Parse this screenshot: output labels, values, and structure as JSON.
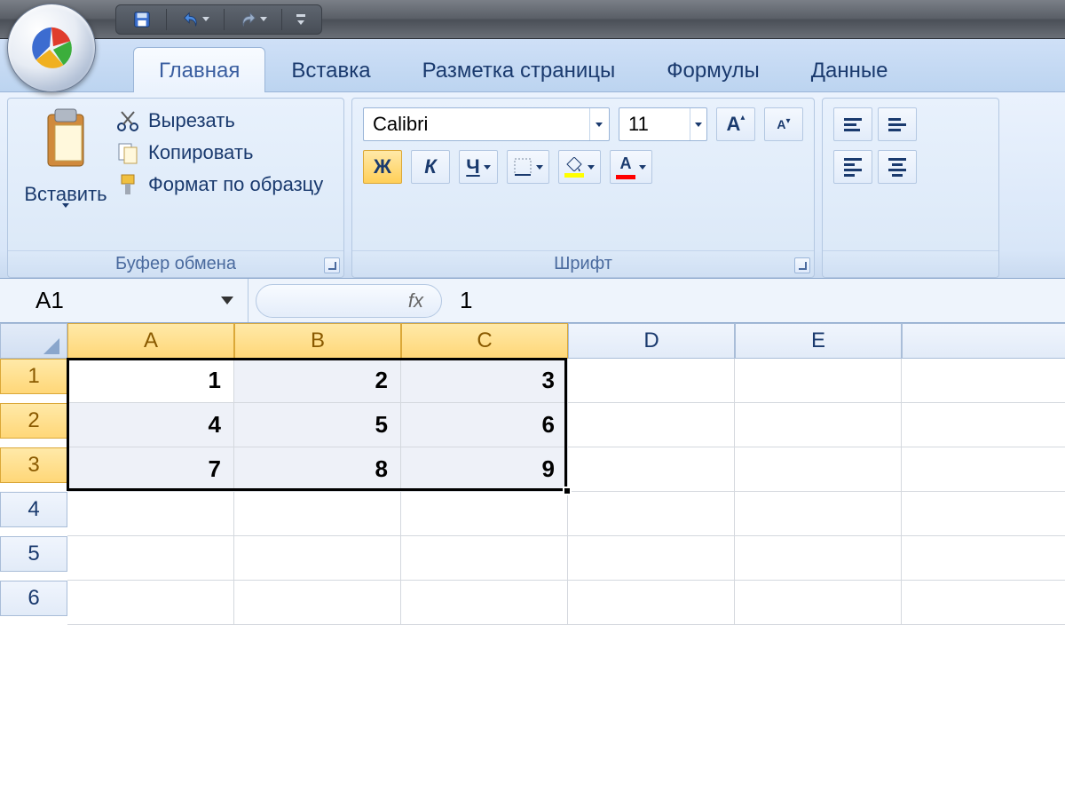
{
  "qat": {
    "save": "save-icon",
    "undo": "undo-icon",
    "redo": "redo-icon"
  },
  "tabs": [
    {
      "label": "Главная",
      "active": true
    },
    {
      "label": "Вставка"
    },
    {
      "label": "Разметка страницы"
    },
    {
      "label": "Формулы"
    },
    {
      "label": "Данные"
    }
  ],
  "clipboard": {
    "paste": "Вставить",
    "cut": "Вырезать",
    "copy": "Копировать",
    "format_painter": "Формат по образцу",
    "group_label": "Буфер обмена"
  },
  "font": {
    "name": "Calibri",
    "size": "11",
    "bold": "Ж",
    "italic": "К",
    "underline": "Ч",
    "group_label": "Шрифт",
    "grow": "A",
    "shrink": "A",
    "font_color": "A",
    "fill_color": "◇"
  },
  "formula_bar": {
    "cell_ref": "A1",
    "fx": "fx",
    "value": "1"
  },
  "columns": [
    "A",
    "B",
    "C",
    "D",
    "E",
    ""
  ],
  "rows": [
    "1",
    "2",
    "3",
    "4",
    "5",
    "6"
  ],
  "selected_cols": [
    "A",
    "B",
    "C"
  ],
  "selected_rows": [
    "1",
    "2",
    "3"
  ],
  "cells": {
    "A1": "1",
    "B1": "2",
    "C1": "3",
    "A2": "4",
    "B2": "5",
    "C2": "6",
    "A3": "7",
    "B3": "8",
    "C3": "9"
  },
  "active_cell": "A1",
  "selection": {
    "startCol": "A",
    "endCol": "C",
    "startRow": 1,
    "endRow": 3
  }
}
